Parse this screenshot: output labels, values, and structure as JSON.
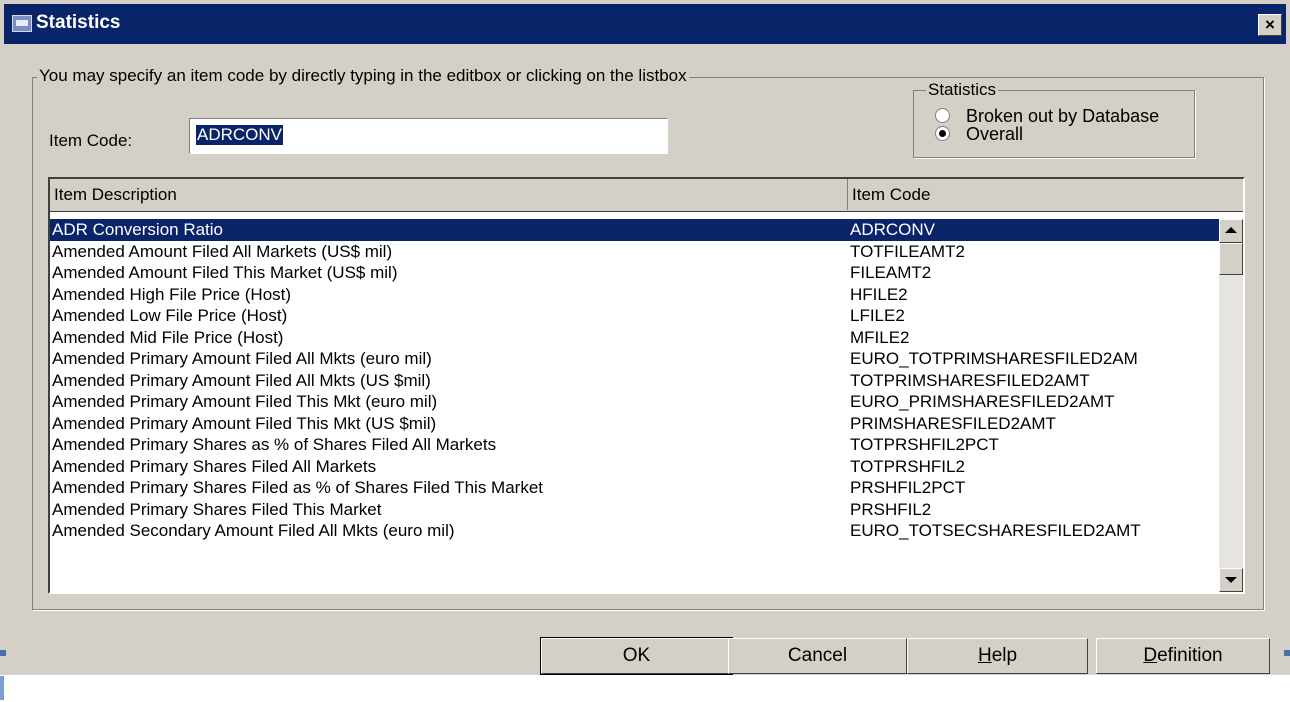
{
  "window": {
    "title": "Statistics",
    "close_glyph": "×",
    "icon": "app-icon"
  },
  "main_group": {
    "legend": "You may specify an item code by directly typing in the editbox or clicking on the listbox"
  },
  "item_code": {
    "label": "Item Code:",
    "value": "ADRCONV"
  },
  "statistics_group": {
    "legend": "Statistics",
    "options": [
      {
        "label": "Broken out by Database",
        "checked": false
      },
      {
        "label": "Overall",
        "checked": true
      }
    ]
  },
  "list": {
    "columns": [
      "Item Description",
      "Item Code"
    ],
    "selected_index": 0,
    "rows": [
      {
        "description": "ADR Conversion Ratio",
        "code": "ADRCONV"
      },
      {
        "description": "Amended Amount Filed All Markets (US$ mil)",
        "code": "TOTFILEAMT2"
      },
      {
        "description": "Amended Amount Filed This Market (US$ mil)",
        "code": "FILEAMT2"
      },
      {
        "description": "Amended High File Price (Host)",
        "code": "HFILE2"
      },
      {
        "description": "Amended Low File Price (Host)",
        "code": "LFILE2"
      },
      {
        "description": "Amended Mid File Price (Host)",
        "code": "MFILE2"
      },
      {
        "description": "Amended Primary Amount Filed All Mkts (euro mil)",
        "code": "EURO_TOTPRIMSHARESFILED2AM"
      },
      {
        "description": "Amended Primary Amount Filed All Mkts (US $mil)",
        "code": "TOTPRIMSHARESFILED2AMT"
      },
      {
        "description": "Amended Primary Amount Filed This Mkt (euro mil)",
        "code": "EURO_PRIMSHARESFILED2AMT"
      },
      {
        "description": "Amended Primary Amount Filed This Mkt (US $mil)",
        "code": "PRIMSHARESFILED2AMT"
      },
      {
        "description": "Amended Primary Shares as % of Shares Filed All Markets",
        "code": "TOTPRSHFIL2PCT"
      },
      {
        "description": "Amended Primary Shares Filed All Markets",
        "code": "TOTPRSHFIL2"
      },
      {
        "description": "Amended Primary Shares Filed as % of Shares Filed This Market",
        "code": "PRSHFIL2PCT"
      },
      {
        "description": "Amended Primary Shares Filed This Market",
        "code": "PRSHFIL2"
      },
      {
        "description": "Amended Secondary Amount Filed All Mkts (euro mil)",
        "code": "EURO_TOTSECSHARESFILED2AMT"
      }
    ]
  },
  "buttons": {
    "ok": "OK",
    "cancel": "Cancel",
    "help_mnemonic": "H",
    "help_rest": "elp",
    "definition_mnemonic": "D",
    "definition_rest": "efinition"
  }
}
